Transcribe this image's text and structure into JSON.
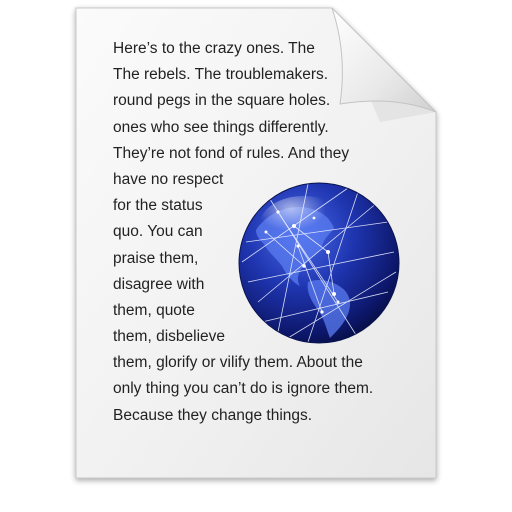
{
  "document_icon": {
    "icon": "rich-text-document-icon",
    "page_color": "#f4f4f4",
    "fold_color": "#e3e3e3",
    "text_color": "#222222",
    "lines": [
      "Here’s to the crazy ones. The",
      "The rebels. The troublemakers.",
      "round pegs in the square holes.",
      "ones who see things differently.",
      "They’re not fond of rules. And they",
      "have no respect",
      "for the status",
      "quo. You can",
      "praise them,",
      "disagree with",
      "them, quote",
      "them, disbelieve",
      "them, glorify or vilify them. About the",
      "only thing you can’t do is ignore them.",
      "Because they change things."
    ],
    "embedded_image": {
      "icon": "network-globe-icon",
      "color": "#1b2fa8"
    }
  }
}
